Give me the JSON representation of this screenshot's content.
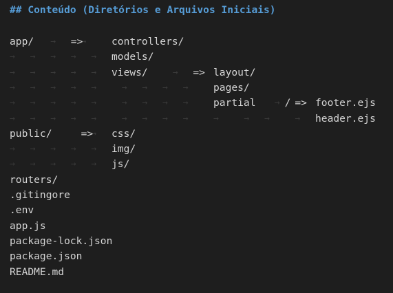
{
  "heading": "## Conteúdo (Diretórios e Arquivos Iniciais)",
  "arrow": "=>",
  "tab_glyph": "→",
  "space_glyph": "·",
  "lines": [
    {
      "items": [
        {
          "col": 0,
          "text": "app/"
        },
        {
          "col": 6,
          "text": "=>"
        },
        {
          "col": 10,
          "text": "controllers/"
        }
      ],
      "tabs": [
        4,
        7
      ]
    },
    {
      "items": [
        {
          "col": 10,
          "text": "models/"
        }
      ],
      "tabs": [
        0,
        2,
        4,
        6,
        8
      ]
    },
    {
      "items": [
        {
          "col": 10,
          "text": "views/"
        },
        {
          "col": 18,
          "text": "=>"
        },
        {
          "col": 20,
          "text": "layout/"
        }
      ],
      "tabs": [
        0,
        2,
        4,
        6,
        8,
        16
      ]
    },
    {
      "items": [
        {
          "col": 20,
          "text": "pages/"
        }
      ],
      "tabs": [
        0,
        2,
        4,
        6,
        8,
        11,
        13,
        15,
        17
      ]
    },
    {
      "items": [
        {
          "col": 20,
          "text": "partial"
        },
        {
          "col": 27,
          "text": "/"
        },
        {
          "col": 28,
          "text": "=>"
        },
        {
          "col": 30,
          "text": "footer.ejs"
        }
      ],
      "tabs": [
        0,
        2,
        4,
        6,
        8,
        11,
        13,
        15,
        17,
        26
      ]
    },
    {
      "items": [
        {
          "col": 30,
          "text": "header.ejs"
        }
      ],
      "tabs": [
        0,
        2,
        4,
        6,
        8,
        11,
        13,
        15,
        17,
        20,
        23,
        25,
        28
      ]
    },
    {
      "items": [
        {
          "col": 0,
          "text": "public/"
        },
        {
          "col": 7,
          "text": "=>"
        },
        {
          "col": 10,
          "text": "css/"
        }
      ],
      "tabs": [
        8
      ]
    },
    {
      "items": [
        {
          "col": 10,
          "text": "img/"
        }
      ],
      "tabs": [
        0,
        2,
        4,
        6,
        8
      ]
    },
    {
      "items": [
        {
          "col": 10,
          "text": "js/"
        }
      ],
      "tabs": [
        0,
        2,
        4,
        6,
        8
      ]
    },
    {
      "items": [
        {
          "col": 0,
          "text": "routers/"
        }
      ],
      "tabs": []
    },
    {
      "items": [
        {
          "col": 0,
          "text": ".gitingore"
        }
      ],
      "tabs": []
    },
    {
      "items": [
        {
          "col": 0,
          "text": ".env"
        }
      ],
      "tabs": []
    },
    {
      "items": [
        {
          "col": 0,
          "text": "app.js"
        }
      ],
      "tabs": []
    },
    {
      "items": [
        {
          "col": 0,
          "text": "package-lock.json"
        }
      ],
      "tabs": []
    },
    {
      "items": [
        {
          "col": 0,
          "text": "package.json"
        }
      ],
      "tabs": []
    },
    {
      "items": [
        {
          "col": 0,
          "text": "README.md"
        }
      ],
      "tabs": []
    }
  ]
}
